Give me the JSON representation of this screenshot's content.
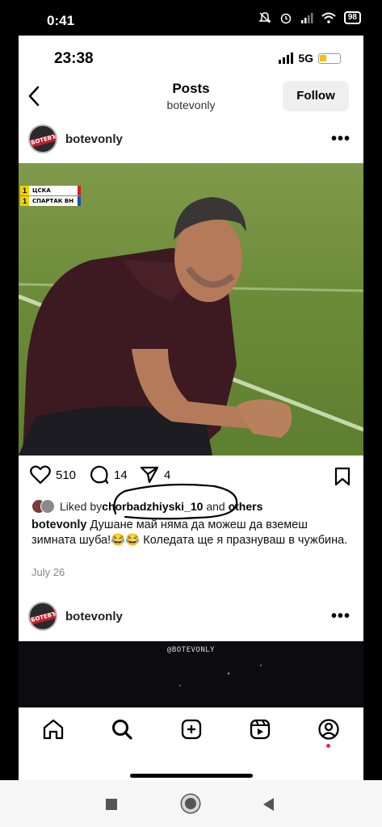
{
  "system_status": {
    "time": "0:41",
    "battery": "98"
  },
  "ig_status": {
    "time": "23:38",
    "network": "5G"
  },
  "header": {
    "title": "Posts",
    "subtitle": "botevonly",
    "follow_label": "Follow"
  },
  "post1": {
    "username": "botevonly",
    "avatar_text": "БОТЕВЪ",
    "scoreboard": [
      {
        "score": "1",
        "team": "ЦСКА",
        "color": "#d31f2a"
      },
      {
        "score": "1",
        "team": "СПАРТАК ВН",
        "color": "#1f4fb4"
      }
    ],
    "likes": "510",
    "comments": "14",
    "shares": "4",
    "liked_by_prefix": "Liked by ",
    "liked_by_user": "chorbadzhiyski_10",
    "liked_by_and": " and ",
    "liked_by_others": "others",
    "caption_user": "botevonly",
    "caption_text": " Душане май няма да можеш да вземеш зимната шуба!😂😂 Коледата ще я празнуваш в чужбина.",
    "date": "July 26"
  },
  "post2": {
    "username": "botevonly",
    "avatar_text": "БОТЕВЪ",
    "watermark": "@BOTEVONLY"
  },
  "tabs": [
    "home",
    "search",
    "create",
    "reels",
    "profile"
  ],
  "colors": {
    "follow_bg": "#efefef",
    "annotation_ink": "#000000",
    "notification_dot": "#e0245e"
  }
}
